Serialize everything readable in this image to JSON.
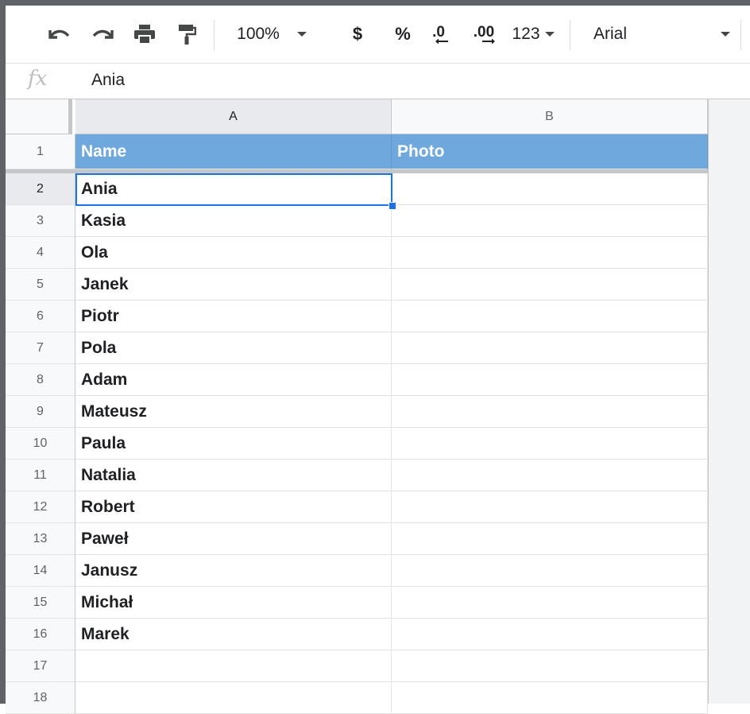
{
  "toolbar": {
    "zoom": "100%",
    "currency": "$",
    "percent": "%",
    "decrease_decimal": ".0",
    "increase_decimal": ".00",
    "format_more": "123",
    "font": "Arial"
  },
  "formula_bar": {
    "fx_label": "fx",
    "value": "Ania"
  },
  "columns": [
    "A",
    "B"
  ],
  "header_row": {
    "row": "1",
    "a": "Name",
    "b": "Photo"
  },
  "rows": [
    {
      "num": "2",
      "a": "Ania"
    },
    {
      "num": "3",
      "a": "Kasia"
    },
    {
      "num": "4",
      "a": "Ola"
    },
    {
      "num": "5",
      "a": "Janek"
    },
    {
      "num": "6",
      "a": "Piotr"
    },
    {
      "num": "7",
      "a": "Pola"
    },
    {
      "num": "8",
      "a": "Adam"
    },
    {
      "num": "9",
      "a": "Mateusz"
    },
    {
      "num": "10",
      "a": "Paula"
    },
    {
      "num": "11",
      "a": "Natalia"
    },
    {
      "num": "12",
      "a": "Robert"
    },
    {
      "num": "13",
      "a": "Paweł"
    },
    {
      "num": "14",
      "a": "Janusz"
    },
    {
      "num": "15",
      "a": "Michał"
    },
    {
      "num": "16",
      "a": "Marek"
    },
    {
      "num": "17",
      "a": ""
    },
    {
      "num": "18",
      "a": ""
    }
  ],
  "colors": {
    "header_fill": "#6fa8dc",
    "selection": "#1a73e8"
  }
}
